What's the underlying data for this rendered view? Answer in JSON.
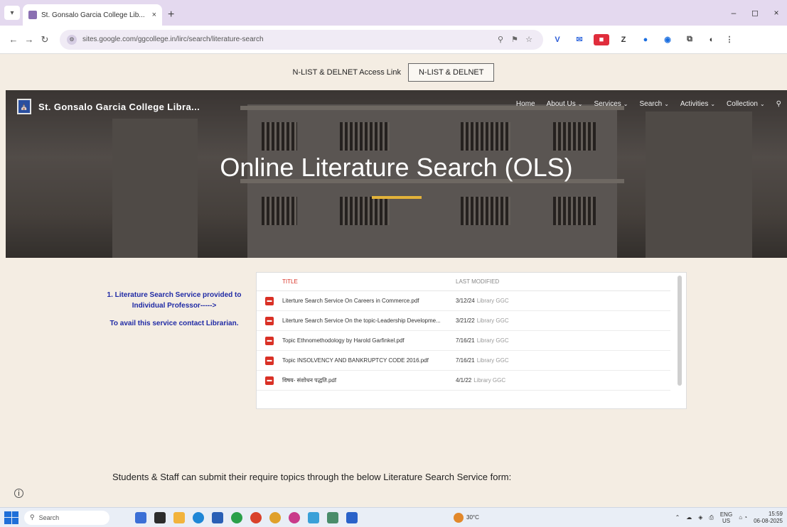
{
  "browser": {
    "tab_title": "St. Gonsalo Garcia College Lib...",
    "tab_close": "×",
    "new_tab": "+",
    "url": "sites.google.com/ggcollege.in/lirc/search/literature-search",
    "window_controls": [
      "–",
      "◻",
      "×"
    ]
  },
  "announcement": {
    "text": "N-LIST & DELNET Access Link",
    "button_label": "N-LIST & DELNET"
  },
  "site": {
    "name": "St. Gonsalo Garcia College Libra...",
    "nav": [
      {
        "label": "Home",
        "dropdown": false
      },
      {
        "label": "About Us",
        "dropdown": true
      },
      {
        "label": "Services",
        "dropdown": true
      },
      {
        "label": "Search",
        "dropdown": true
      },
      {
        "label": "Activities",
        "dropdown": true
      },
      {
        "label": "Collection",
        "dropdown": true
      }
    ],
    "search_icon": "search-icon"
  },
  "hero": {
    "title": "Online Literature Search (OLS)",
    "accent_color": "#e2b23a"
  },
  "service": {
    "line1": "1.   Literature Search Service provided to Individual Professor----->",
    "line2": "To avail this service contact Librarian."
  },
  "files": {
    "col_title": "TITLE",
    "col_modified": "LAST MODIFIED",
    "rows": [
      {
        "name": "Literture Search Service On Careers in Commerce.pdf",
        "date": "3/12/24",
        "by": "Library GGC"
      },
      {
        "name": "Literture Search Service On the topic-Leadership Developme...",
        "date": "3/21/22",
        "by": "Library GGC"
      },
      {
        "name": "Topic Ethnomethodology by Harold Garfinkel.pdf",
        "date": "7/16/21",
        "by": "Library GGC"
      },
      {
        "name": "Topic INSOLVENCY AND BANKRUPTCY CODE 2016.pdf",
        "date": "7/16/21",
        "by": "Library GGC"
      },
      {
        "name": "विषय- संशोधन पद्धति.pdf",
        "date": "4/1/22",
        "by": "Library GGC"
      }
    ]
  },
  "form_note": "Students & Staff can submit their require topics through the below Literature Search Service form:",
  "taskbar": {
    "search_placeholder": "Search",
    "weather": "30°C",
    "lang": "ENG",
    "lang2": "US",
    "time": "15:59",
    "date": "06-08-2025"
  }
}
